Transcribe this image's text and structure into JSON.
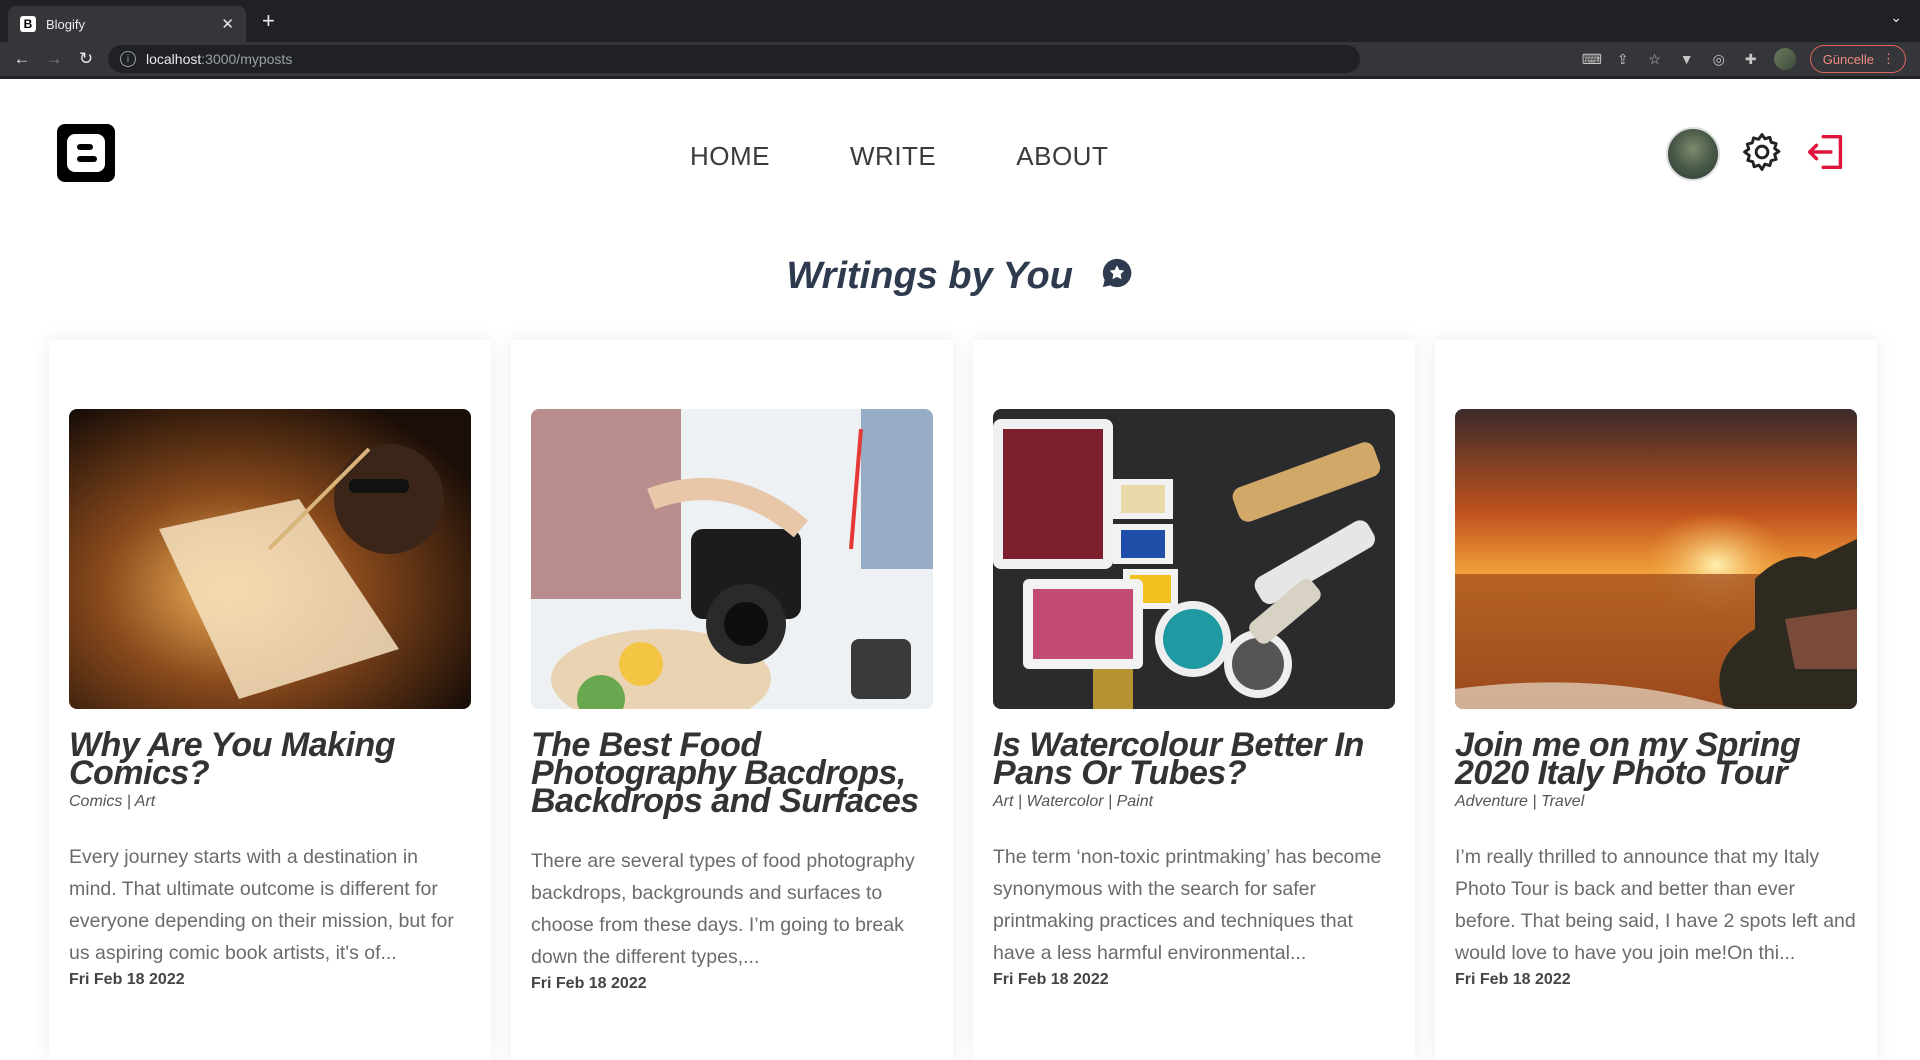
{
  "browser": {
    "tab_title": "Blogify",
    "tab_favicon": "B",
    "url_host": "localhost",
    "url_path": ":3000/myposts",
    "update_label": "Güncelle"
  },
  "site": {
    "nav": {
      "home": "HOME",
      "write": "WRITE",
      "about": "ABOUT"
    },
    "accent_color": "#e0143c",
    "page_title": "Writings by You"
  },
  "posts": [
    {
      "title": "Why Are You Making Comics?",
      "categories": "Comics | Art",
      "excerpt": "Every journey starts with a destination in mind. That ultimate outcome is different for everyone depending on their mission, but for us aspiring comic book artists, it's of...",
      "date": "Fri Feb 18 2022"
    },
    {
      "title": "The Best Food Photography Bacdrops, Backdrops and Surfaces",
      "categories": "",
      "excerpt": "There are several types of food photography backdrops, backgrounds and surfaces to choose from these days. I’m going to break down the different types,...",
      "date": "Fri Feb 18 2022"
    },
    {
      "title": "Is Watercolour Better In Pans Or Tubes?",
      "categories": "Art | Watercolor | Paint",
      "excerpt": "The term ‘non-toxic printmaking’ has become synonymous with the search for safer printmaking practices and techniques that have a less harmful environmental...",
      "date": "Fri Feb 18 2022"
    },
    {
      "title": "Join me on my Spring 2020 Italy Photo Tour",
      "categories": "Adventure | Travel",
      "excerpt": "I’m really thrilled to announce that my Italy Photo Tour is back and better than ever before. That being said, I have 2 spots left and would love to have you join me!On thi...",
      "date": "Fri Feb 18 2022"
    }
  ]
}
